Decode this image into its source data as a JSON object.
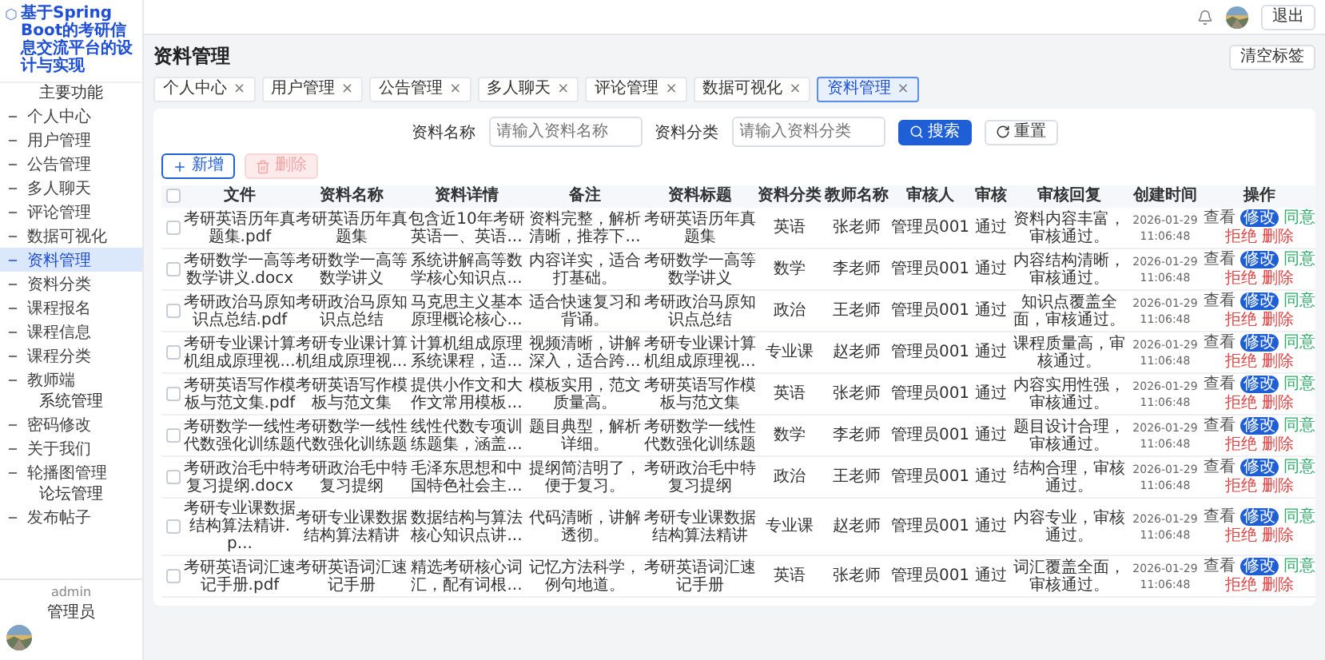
{
  "sidebar": {
    "brand": "基于Spring Boot的考研信息交流平台的设计与实现",
    "groups": [
      {
        "title": "主要功能",
        "items": [
          {
            "label": "个人中心",
            "selected": false
          },
          {
            "label": "用户管理",
            "selected": false
          },
          {
            "label": "公告管理",
            "selected": false
          },
          {
            "label": "多人聊天",
            "selected": false
          },
          {
            "label": "评论管理",
            "selected": false
          },
          {
            "label": "数据可视化",
            "selected": false
          },
          {
            "label": "资料管理",
            "selected": true
          },
          {
            "label": "资料分类",
            "selected": false
          },
          {
            "label": "课程报名",
            "selected": false
          },
          {
            "label": "课程信息",
            "selected": false
          },
          {
            "label": "课程分类",
            "selected": false
          },
          {
            "label": "教师端",
            "selected": false
          }
        ]
      },
      {
        "title": "系统管理",
        "items": [
          {
            "label": "密码修改",
            "selected": false
          },
          {
            "label": "关于我们",
            "selected": false
          },
          {
            "label": "轮播图管理",
            "selected": false
          }
        ]
      },
      {
        "title": "论坛管理",
        "items": [
          {
            "label": "发布帖子",
            "selected": false
          }
        ]
      }
    ],
    "user": {
      "name": "admin",
      "role": "管理员"
    }
  },
  "header": {
    "logout": "退出"
  },
  "page": {
    "title": "资料管理",
    "clear_tabs": "清空标签"
  },
  "tabs": [
    {
      "label": "个人中心",
      "selected": false,
      "close": "×"
    },
    {
      "label": "用户管理",
      "selected": false,
      "close": "×"
    },
    {
      "label": "公告管理",
      "selected": false,
      "close": "×"
    },
    {
      "label": "多人聊天",
      "selected": false,
      "close": "×"
    },
    {
      "label": "评论管理",
      "selected": false,
      "close": "×"
    },
    {
      "label": "数据可视化",
      "selected": false,
      "close": "×"
    },
    {
      "label": "资料管理",
      "selected": true,
      "close": "×"
    }
  ],
  "filters": [
    {
      "label": "资料名称",
      "placeholder": "请输入资料名称"
    },
    {
      "label": "资料分类",
      "placeholder": "请输入资料分类"
    }
  ],
  "search_button": "搜索",
  "reset_button": "重置",
  "add_button": "新增",
  "delete_button": {
    "label": "删除",
    "disabled": true
  },
  "table": {
    "all_checked": false,
    "columns": [
      "文件",
      "资料名称",
      "资料详情",
      "备注",
      "资料标题",
      "资料分类",
      "教师名称",
      "审核人",
      "审核",
      "审核回复",
      "创建时间",
      "操作"
    ],
    "rows": [
      {
        "checked": false,
        "cells": [
          "考研英语历年真题集.pdf",
          "考研英语历年真题集",
          "包含近10年考研英语一、英语...",
          "资料完整，解析清晰，推荐下...",
          "考研英语历年真题集",
          "英语",
          "张老师",
          "管理员001",
          "通过",
          "资料内容丰富，审核通过。",
          "2026-01-29 11:06:48"
        ],
        "actions": [
          {
            "label": "查看",
            "kind": "view"
          },
          {
            "label": "修改",
            "kind": "edit"
          },
          {
            "label": "同意",
            "kind": "approve"
          },
          {
            "label": "拒绝",
            "kind": "reject"
          },
          {
            "label": "删除",
            "kind": "delete"
          }
        ]
      },
      {
        "checked": false,
        "cells": [
          "考研数学一高等数学讲义.docx",
          "考研数学一高等数学讲义",
          "系统讲解高等数学核心知识点...",
          "内容详实，适合打基础。",
          "考研数学一高等数学讲义",
          "数学",
          "李老师",
          "管理员001",
          "通过",
          "内容结构清晰，审核通过。",
          "2026-01-29 11:06:48"
        ],
        "actions": [
          {
            "label": "查看",
            "kind": "view"
          },
          {
            "label": "修改",
            "kind": "edit"
          },
          {
            "label": "同意",
            "kind": "approve"
          },
          {
            "label": "拒绝",
            "kind": "reject"
          },
          {
            "label": "删除",
            "kind": "delete"
          }
        ]
      },
      {
        "checked": false,
        "cells": [
          "考研政治马原知识点总结.pdf",
          "考研政治马原知识点总结",
          "马克思主义基本原理概论核心...",
          "适合快速复习和背诵。",
          "考研政治马原知识点总结",
          "政治",
          "王老师",
          "管理员001",
          "通过",
          "知识点覆盖全面，审核通过。",
          "2026-01-29 11:06:48"
        ],
        "actions": [
          {
            "label": "查看",
            "kind": "view"
          },
          {
            "label": "修改",
            "kind": "edit"
          },
          {
            "label": "同意",
            "kind": "approve"
          },
          {
            "label": "拒绝",
            "kind": "reject"
          },
          {
            "label": "删除",
            "kind": "delete"
          }
        ]
      },
      {
        "checked": false,
        "cells": [
          "考研专业课计算机组成原理视...",
          "考研专业课计算机组成原理视...",
          "计算机组成原理系统课程，适...",
          "视频清晰，讲解深入，适合跨...",
          "考研专业课计算机组成原理视...",
          "专业课",
          "赵老师",
          "管理员001",
          "通过",
          "课程质量高，审核通过。",
          "2026-01-29 11:06:48"
        ],
        "actions": [
          {
            "label": "查看",
            "kind": "view"
          },
          {
            "label": "修改",
            "kind": "edit"
          },
          {
            "label": "同意",
            "kind": "approve"
          },
          {
            "label": "拒绝",
            "kind": "reject"
          },
          {
            "label": "删除",
            "kind": "delete"
          }
        ]
      },
      {
        "checked": false,
        "cells": [
          "考研英语写作模板与范文集.pdf",
          "考研英语写作模板与范文集",
          "提供小作文和大作文常用模板...",
          "模板实用，范文质量高。",
          "考研英语写作模板与范文集",
          "英语",
          "张老师",
          "管理员001",
          "通过",
          "内容实用性强，审核通过。",
          "2026-01-29 11:06:48"
        ],
        "actions": [
          {
            "label": "查看",
            "kind": "view"
          },
          {
            "label": "修改",
            "kind": "edit"
          },
          {
            "label": "同意",
            "kind": "approve"
          },
          {
            "label": "拒绝",
            "kind": "reject"
          },
          {
            "label": "删除",
            "kind": "delete"
          }
        ]
      },
      {
        "checked": false,
        "cells": [
          "考研数学一线性代数强化训练题",
          "考研数学一线性代数强化训练题",
          "线性代数专项训练题集，涵盖...",
          "题目典型，解析详细。",
          "考研数学一线性代数强化训练题",
          "数学",
          "李老师",
          "管理员001",
          "通过",
          "题目设计合理，审核通过。",
          "2026-01-29 11:06:48"
        ],
        "actions": [
          {
            "label": "查看",
            "kind": "view"
          },
          {
            "label": "修改",
            "kind": "edit"
          },
          {
            "label": "同意",
            "kind": "approve"
          },
          {
            "label": "拒绝",
            "kind": "reject"
          },
          {
            "label": "删除",
            "kind": "delete"
          }
        ]
      },
      {
        "checked": false,
        "cells": [
          "考研政治毛中特复习提纲.docx",
          "考研政治毛中特复习提纲",
          "毛泽东思想和中国特色社会主...",
          "提纲简洁明了，便于复习。",
          "考研政治毛中特复习提纲",
          "政治",
          "王老师",
          "管理员001",
          "通过",
          "结构合理，审核通过。",
          "2026-01-29 11:06:48"
        ],
        "actions": [
          {
            "label": "查看",
            "kind": "view"
          },
          {
            "label": "修改",
            "kind": "edit"
          },
          {
            "label": "同意",
            "kind": "approve"
          },
          {
            "label": "拒绝",
            "kind": "reject"
          },
          {
            "label": "删除",
            "kind": "delete"
          }
        ]
      },
      {
        "checked": false,
        "cells": [
          "考研专业课数据结构算法精讲.p...",
          "考研专业课数据结构算法精讲",
          "数据结构与算法核心知识点讲...",
          "代码清晰，讲解透彻。",
          "考研专业课数据结构算法精讲",
          "专业课",
          "赵老师",
          "管理员001",
          "通过",
          "内容专业，审核通过。",
          "2026-01-29 11:06:48"
        ],
        "actions": [
          {
            "label": "查看",
            "kind": "view"
          },
          {
            "label": "修改",
            "kind": "edit"
          },
          {
            "label": "同意",
            "kind": "approve"
          },
          {
            "label": "拒绝",
            "kind": "reject"
          },
          {
            "label": "删除",
            "kind": "delete"
          }
        ]
      },
      {
        "checked": false,
        "cells": [
          "考研英语词汇速记手册.pdf",
          "考研英语词汇速记手册",
          "精选考研核心词汇，配有词根...",
          "记忆方法科学，例句地道。",
          "考研英语词汇速记手册",
          "英语",
          "张老师",
          "管理员001",
          "通过",
          "词汇覆盖全面，审核通过。",
          "2026-01-29 11:06:48"
        ],
        "actions": [
          {
            "label": "查看",
            "kind": "view"
          },
          {
            "label": "修改",
            "kind": "edit"
          },
          {
            "label": "同意",
            "kind": "approve"
          },
          {
            "label": "拒绝",
            "kind": "reject"
          },
          {
            "label": "删除",
            "kind": "delete"
          }
        ]
      }
    ]
  }
}
